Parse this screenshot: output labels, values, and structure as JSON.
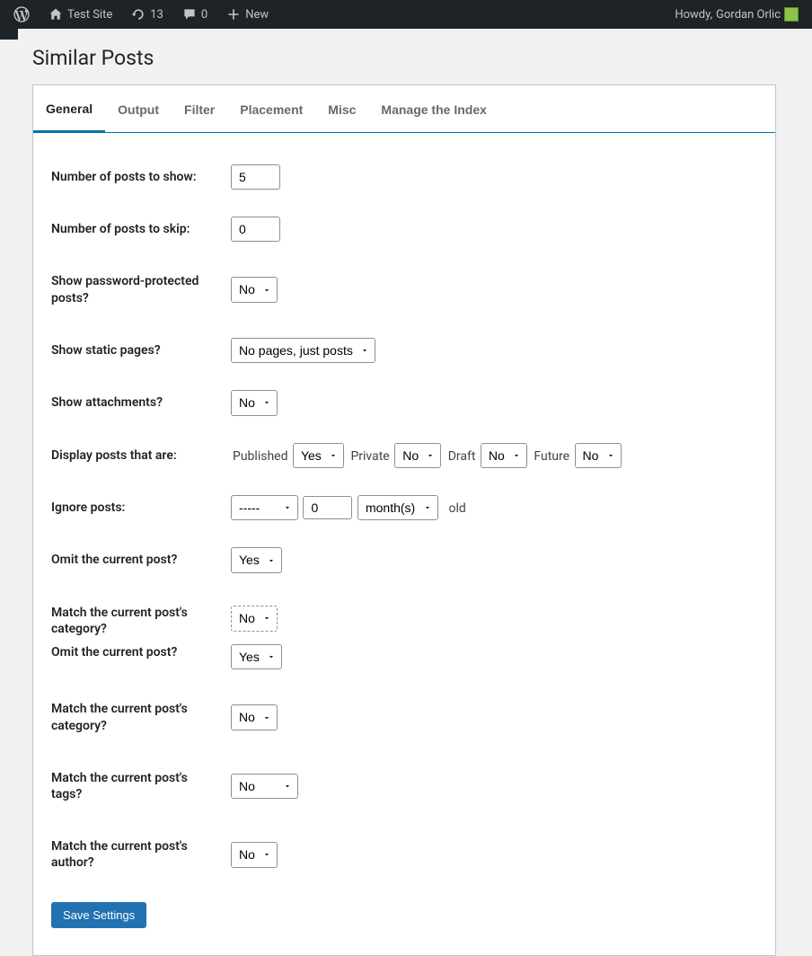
{
  "adminbar": {
    "site_name": "Test Site",
    "updates_count": "13",
    "comments_count": "0",
    "new_label": "New",
    "howdy_prefix": "Howdy,",
    "user_name": "Gordan Orlic"
  },
  "page": {
    "title": "Similar Posts"
  },
  "tabs": [
    {
      "label": "General",
      "active": true
    },
    {
      "label": "Output",
      "active": false
    },
    {
      "label": "Filter",
      "active": false
    },
    {
      "label": "Placement",
      "active": false
    },
    {
      "label": "Misc",
      "active": false
    },
    {
      "label": "Manage the Index",
      "active": false
    }
  ],
  "options": {
    "yes": "Yes",
    "no": "No"
  },
  "fields": {
    "num_show": {
      "label": "Number of posts to show:",
      "value": "5"
    },
    "num_skip": {
      "label": "Number of posts to skip:",
      "value": "0"
    },
    "show_pw": {
      "label": "Show password-protected posts?",
      "value": "No"
    },
    "show_static": {
      "label": "Show static pages?",
      "value": "No pages, just posts"
    },
    "show_attach": {
      "label": "Show attachments?",
      "value": "No"
    },
    "display_status": {
      "label": "Display posts that are:",
      "published_label": "Published",
      "published": "Yes",
      "private_label": "Private",
      "private": "No",
      "draft_label": "Draft",
      "draft": "No",
      "future_label": "Future",
      "future": "No"
    },
    "ignore": {
      "label": "Ignore posts:",
      "compare": "-----",
      "amount": "0",
      "unit": "month(s)",
      "suffix": "old"
    },
    "omit_current_1": {
      "label": "Omit the current post?",
      "value": "Yes"
    },
    "match_cat_1": {
      "label": "Match the current post's category?",
      "value": "No"
    },
    "omit_current_2": {
      "label": "Omit the current post?",
      "value": "Yes"
    },
    "match_cat_2": {
      "label": "Match the current post's category?",
      "value": "No"
    },
    "match_tags": {
      "label": "Match the current post's tags?",
      "value": "No"
    },
    "match_author": {
      "label": "Match the current post's author?",
      "value": "No"
    }
  },
  "buttons": {
    "save": "Save Settings"
  }
}
